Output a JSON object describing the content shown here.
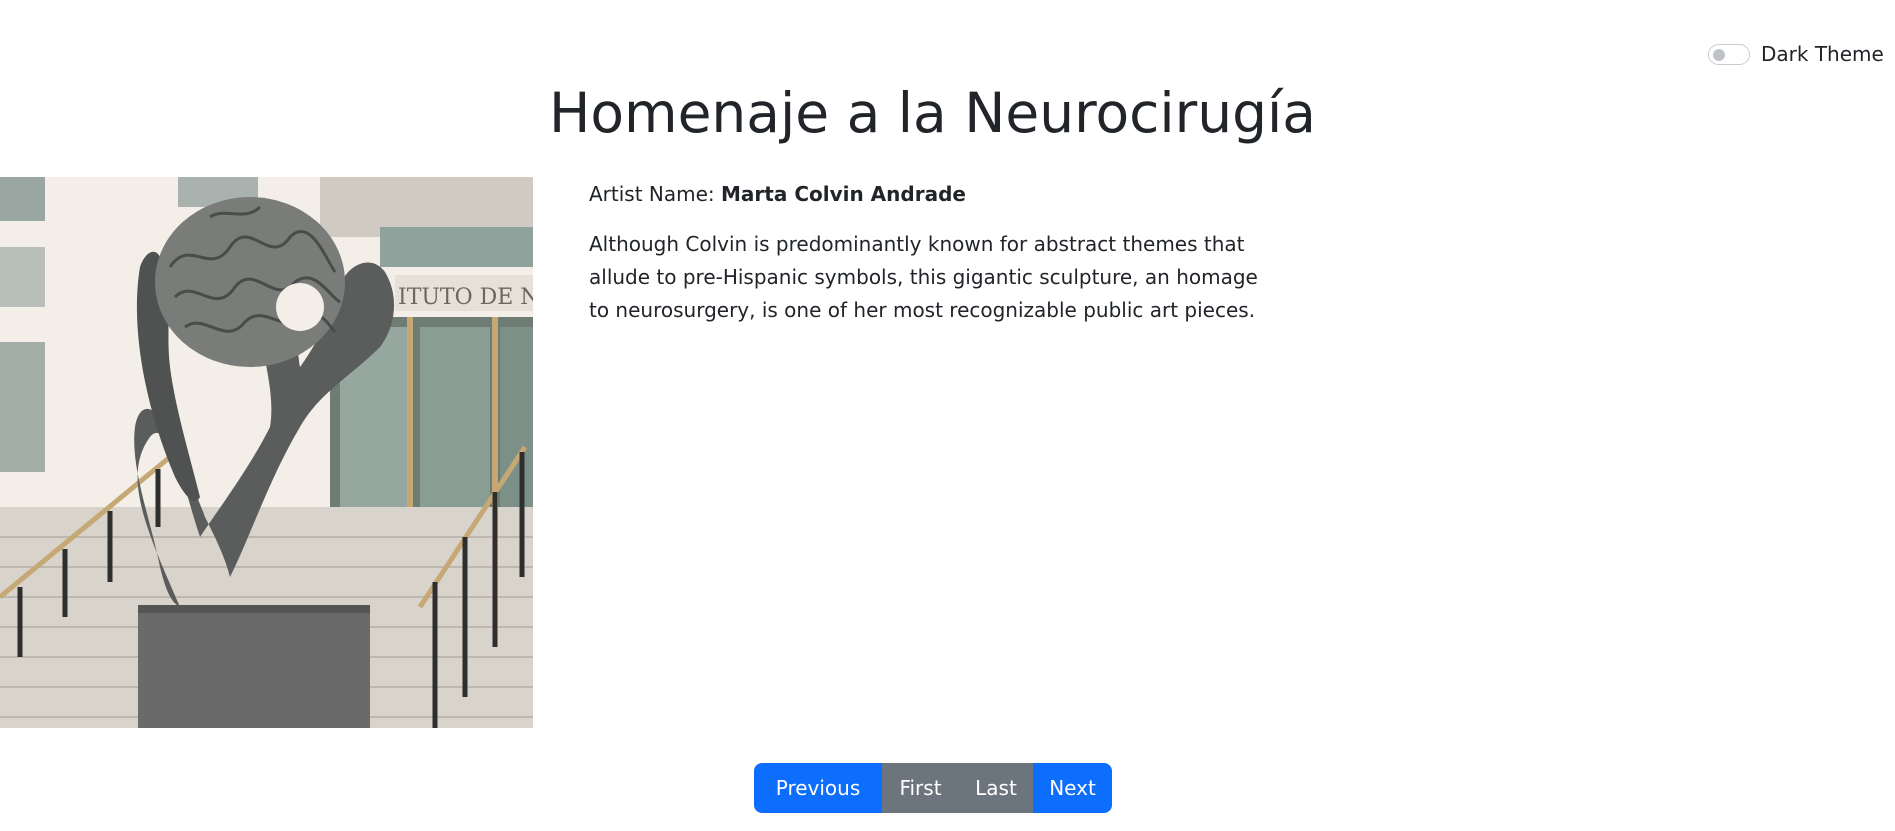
{
  "theme_toggle": {
    "label": "Dark Theme",
    "checked": false
  },
  "artwork": {
    "title": "Homenaje a la Neurocirugía",
    "artist_label": "Artist Name:",
    "artist_name": "Marta Colvin Andrade",
    "description": "Although Colvin is predominantly known for abstract themes that allude to pre-Hispanic symbols, this gigantic sculpture, an homage to neurosurgery, is one of her most recognizable public art pieces.",
    "building_sign": "ITUTO DE NE"
  },
  "pagination": {
    "previous": "Previous",
    "first": "First",
    "last": "Last",
    "next": "Next"
  },
  "colors": {
    "primary": "#0d6efd",
    "secondary": "#6c757d",
    "text": "#212529"
  }
}
